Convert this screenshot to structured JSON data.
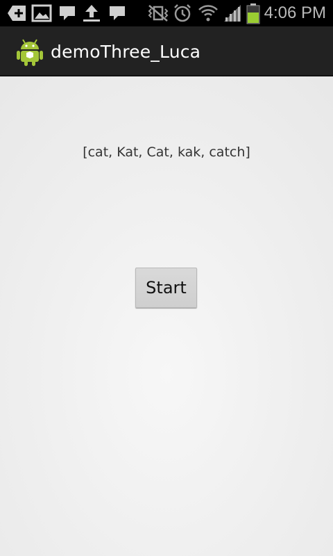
{
  "status_bar": {
    "time": "4:06 PM",
    "icons": [
      "add-icon",
      "gallery-icon",
      "message-icon",
      "upload-icon",
      "message-icon",
      "vibrate-mute-icon",
      "alarm-icon",
      "wifi-icon",
      "signal-icon",
      "battery-icon"
    ],
    "battery_color": "#9acd32"
  },
  "action_bar": {
    "title": "demoThree_Luca",
    "app_icon": "android-icon",
    "accent": "#a4c639"
  },
  "content": {
    "words_text": "[cat, Kat, Cat, kak, catch]",
    "start_label": "Start"
  }
}
